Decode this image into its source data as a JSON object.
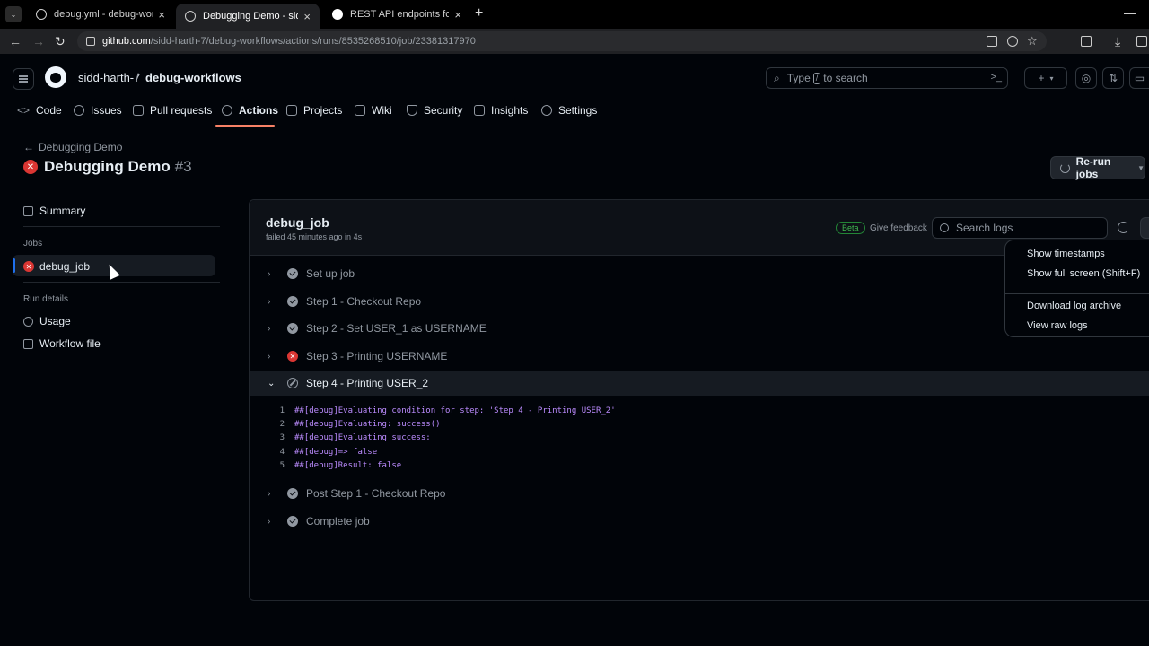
{
  "browser": {
    "tabs": [
      {
        "title": "debug.yml - debug-workflows"
      },
      {
        "title": "Debugging Demo - sidd-harth-"
      },
      {
        "title": "REST API endpoints for workflo"
      }
    ],
    "url_host": "github.com",
    "url_path": "/sidd-harth-7/debug-workflows/actions/runs/8535268510/job/23381317970"
  },
  "header": {
    "owner": "sidd-harth-7",
    "slash": "/",
    "repo": "debug-workflows",
    "search_prefix": "Type",
    "search_key": "/",
    "search_suffix": "to search",
    "plus": "+"
  },
  "repo_nav": [
    {
      "label": "Code",
      "icon": "code-icon"
    },
    {
      "label": "Issues",
      "icon": "issue-icon"
    },
    {
      "label": "Pull requests",
      "icon": "pull-request-icon"
    },
    {
      "label": "Actions",
      "icon": "play-icon"
    },
    {
      "label": "Projects",
      "icon": "table-icon"
    },
    {
      "label": "Wiki",
      "icon": "book-icon"
    },
    {
      "label": "Security",
      "icon": "shield-icon"
    },
    {
      "label": "Insights",
      "icon": "graph-icon"
    },
    {
      "label": "Settings",
      "icon": "gear-icon"
    }
  ],
  "run": {
    "back_label": "Debugging Demo",
    "title": "Debugging Demo",
    "number": "#3",
    "rerun_label": "Re-run jobs"
  },
  "sidebar": {
    "summary": "Summary",
    "jobs_label": "Jobs",
    "job": "debug_job",
    "run_details_label": "Run details",
    "usage": "Usage",
    "workflow_file": "Workflow file"
  },
  "job": {
    "name": "debug_job",
    "meta": "failed 45 minutes ago in 4s",
    "beta": "Beta",
    "feedback": "Give feedback",
    "search_placeholder": "Search logs",
    "steps": [
      {
        "label": "Set up job",
        "status": "success"
      },
      {
        "label": "Step 1 - Checkout Repo",
        "status": "success"
      },
      {
        "label": "Step 2 - Set USER_1 as USERNAME",
        "status": "success"
      },
      {
        "label": "Step 3 - Printing USERNAME",
        "status": "failure"
      },
      {
        "label": "Step 4 - Printing USER_2",
        "status": "skipped"
      },
      {
        "label": "Post Step 1 - Checkout Repo",
        "status": "success"
      },
      {
        "label": "Complete job",
        "status": "success"
      }
    ],
    "log_lines": [
      {
        "n": "1",
        "text": "##[debug]Evaluating condition for step: 'Step 4 - Printing USER_2'"
      },
      {
        "n": "2",
        "text": "##[debug]Evaluating: success()"
      },
      {
        "n": "3",
        "text": "##[debug]Evaluating success:"
      },
      {
        "n": "4",
        "text": "##[debug]=> false"
      },
      {
        "n": "5",
        "text": "##[debug]Result: false"
      }
    ]
  },
  "menu": {
    "show_timestamps": "Show timestamps",
    "full_screen": "Show full screen (Shift+F)",
    "download_archive": "Download log archive",
    "view_raw": "View raw logs"
  },
  "colors": {
    "accent_underline": "#f78166",
    "failure": "#da3633",
    "beta": "#3fb950",
    "log_text": "#bc8cff"
  }
}
